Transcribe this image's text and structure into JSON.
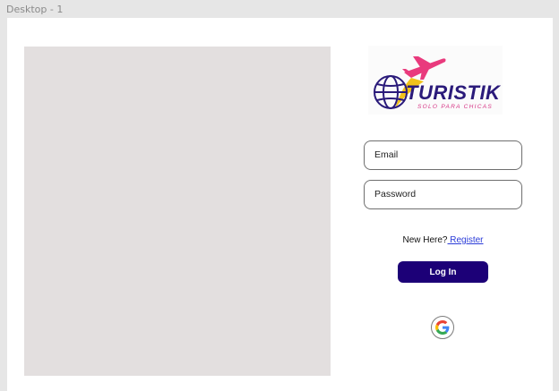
{
  "canvas": {
    "frame_label": "Desktop - 1"
  },
  "logo": {
    "word": "TURISTIK",
    "tagline": "SOLO PARA CHICAS",
    "brand_color": "#2a1a7a",
    "accent_color": "#d63384",
    "icons": [
      "globe-icon",
      "airplane-icon"
    ]
  },
  "form": {
    "email_placeholder": "Email",
    "password_placeholder": "Password",
    "new_here_text": "New Here?",
    "register_link": " Register",
    "login_label": "Log In",
    "login_color": "#1c0077",
    "google_icon": "google-icon"
  },
  "hero": {
    "fill_color": "#e3dfdf"
  }
}
